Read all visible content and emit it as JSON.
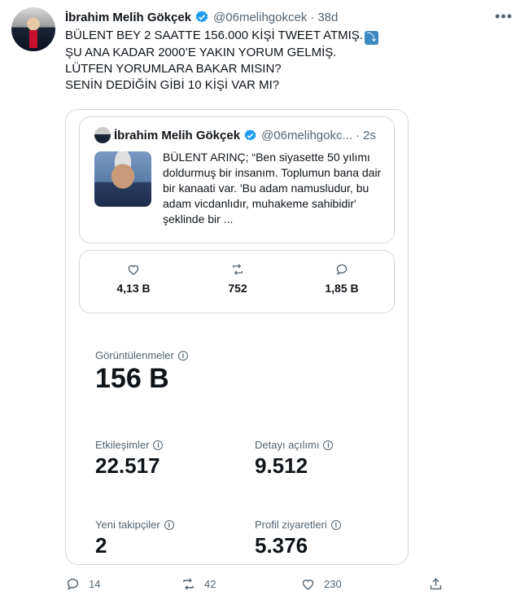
{
  "tweet": {
    "author_name": "İbrahim Melih Gökçek",
    "handle": "@06melihgokcek",
    "separator": "·",
    "time": "38d",
    "text_lines": [
      "BÜLENT BEY 2 SAATTE 156.000 KİŞİ TWEET ATMIŞ.",
      "ŞU ANA KADAR 2000’E YAKIN YORUM GELMİŞ.",
      "LÜTFEN YORUMLARA BAKAR MISIN?",
      "SENİN DEDİĞİN GİBİ 10 KİŞİ  VAR MI?"
    ],
    "emoji": "⤵"
  },
  "quote": {
    "author_name": "İbrahim Melih Gökçek",
    "handle": "@06melihgokc...",
    "separator": "·",
    "time": "2s",
    "text": "BÜLENT ARINÇ; “Ben siyasette 50 yılımı doldurmuş bir insanım. Toplumun bana dair bir kanaati var. 'Bu adam namusludur, bu adam vicdanlıdır, muhakeme sahibidir' şeklinde bir ..."
  },
  "engagement": {
    "likes": "4,13 B",
    "retweets": "752",
    "replies": "1,85 B"
  },
  "analytics": {
    "views_label": "Görüntülenmeler",
    "views_value": "156 B",
    "interactions_label": "Etkileşimler",
    "interactions_value": "22.517",
    "detail_label": "Detayı açılımı",
    "detail_value": "9.512",
    "followers_label": "Yeni takipçiler",
    "followers_value": "2",
    "profile_label": "Profil ziyaretleri",
    "profile_value": "5.376",
    "info_glyph": "i"
  },
  "actions": {
    "reply_count": "14",
    "retweet_count": "42",
    "like_count": "230"
  },
  "colors": {
    "verified": "#1d9bf0",
    "muted": "#536471",
    "border": "#cfd9de",
    "text": "#0f1419"
  }
}
